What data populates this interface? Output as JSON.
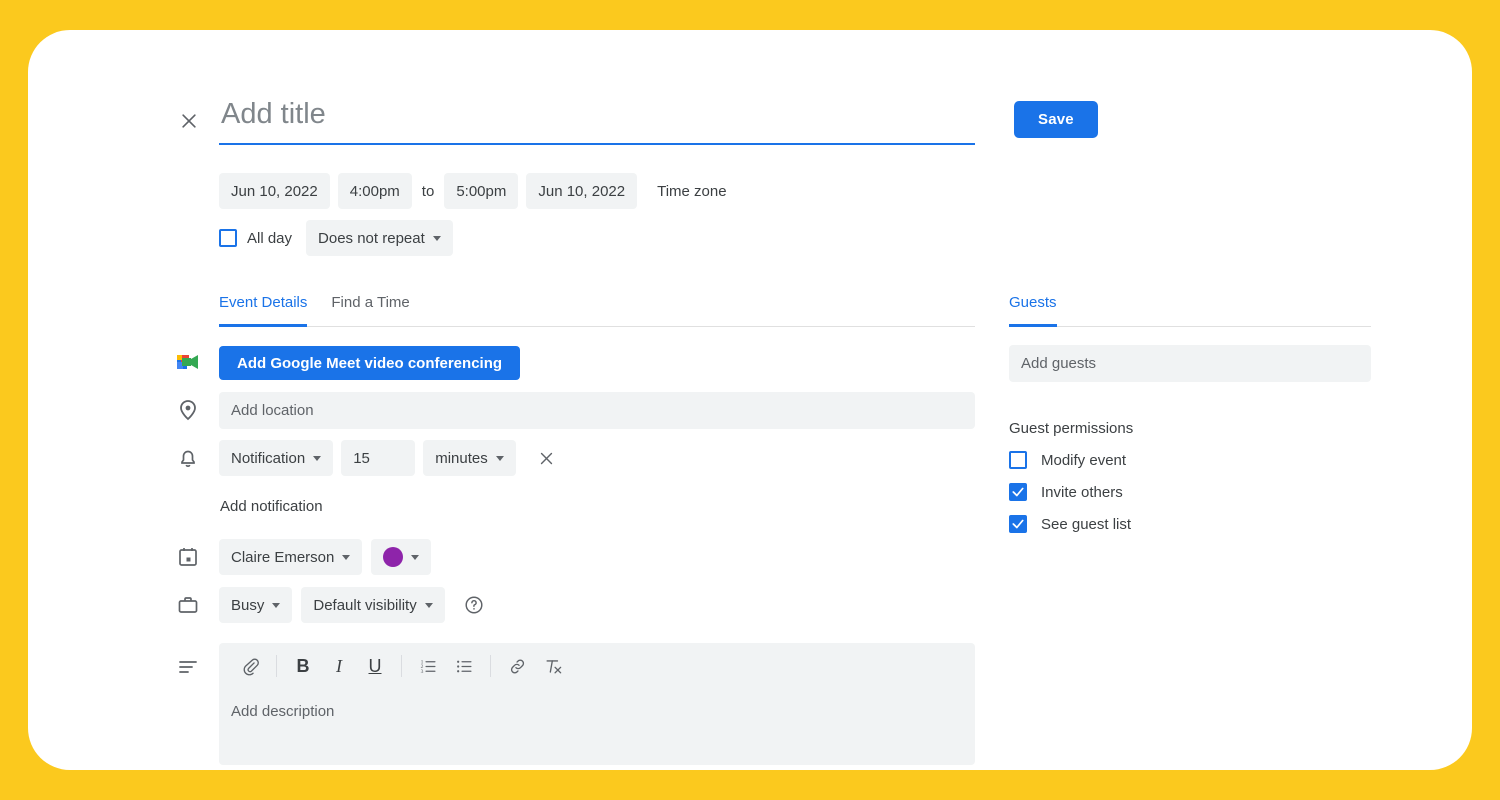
{
  "frame": {
    "border_color": "#FBC91E",
    "card_color": "#FFFFFF"
  },
  "header": {
    "close_icon": "close-icon",
    "title_placeholder": "Add title",
    "title_value": "",
    "save_label": "Save"
  },
  "schedule": {
    "start_date": "Jun 10, 2022",
    "start_time": "4:00pm",
    "to_label": "to",
    "end_time": "5:00pm",
    "end_date": "Jun 10, 2022",
    "time_zone_label": "Time zone",
    "all_day_label": "All day",
    "all_day_checked": false,
    "repeat_label": "Does not repeat"
  },
  "tabs": {
    "left": [
      {
        "label": "Event Details",
        "active": true
      },
      {
        "label": "Find a Time",
        "active": false
      }
    ],
    "right": [
      {
        "label": "Guests",
        "active": true
      }
    ]
  },
  "details": {
    "meet_icon": "google-meet-icon",
    "meet_button_label": "Add Google Meet video conferencing",
    "location_icon": "location-pin-icon",
    "location_placeholder": "Add location",
    "location_value": "",
    "notification_icon": "bell-icon",
    "notification_type": "Notification",
    "notification_amount": "15",
    "notification_unit": "minutes",
    "notification_remove_icon": "close-icon",
    "add_notification_label": "Add notification",
    "calendar_icon": "calendar-icon",
    "calendar_owner": "Claire Emerson",
    "event_color": "#8E24AA",
    "busy_icon": "briefcase-icon",
    "availability": "Busy",
    "visibility": "Default visibility",
    "help_icon": "help-circle-icon",
    "description_icon": "notes-icon",
    "description_placeholder": "Add description",
    "description_value": "",
    "toolbar": [
      {
        "name": "attach-icon",
        "label": ""
      },
      {
        "name": "bold-icon",
        "label": "B"
      },
      {
        "name": "italic-icon",
        "label": "I"
      },
      {
        "name": "underline-icon",
        "label": "U"
      },
      {
        "name": "numbered-list-icon",
        "label": ""
      },
      {
        "name": "bulleted-list-icon",
        "label": ""
      },
      {
        "name": "link-icon",
        "label": ""
      },
      {
        "name": "remove-formatting-icon",
        "label": ""
      }
    ]
  },
  "guests": {
    "add_guests_placeholder": "Add guests",
    "add_guests_value": "",
    "permissions_title": "Guest permissions",
    "permissions": [
      {
        "label": "Modify event",
        "checked": false
      },
      {
        "label": "Invite others",
        "checked": true
      },
      {
        "label": "See guest list",
        "checked": true
      }
    ]
  },
  "colors": {
    "accent_blue": "#1a73e8",
    "field_gray": "#f1f3f4",
    "text_primary": "#3c4043",
    "text_secondary": "#5f6368"
  }
}
